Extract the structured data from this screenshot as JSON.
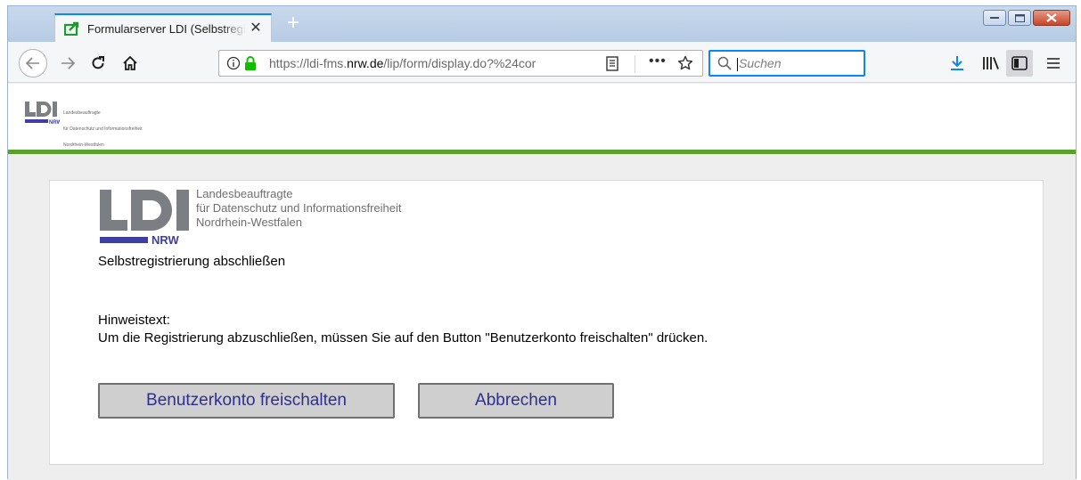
{
  "browser": {
    "tab": {
      "title": "Formularserver LDI (Selbstregistrierung)",
      "close_glyph": "✕"
    },
    "new_tab_glyph": "+",
    "window_controls": [
      "minimize",
      "maximize",
      "close"
    ],
    "url": {
      "prefix": "https://ldi-fms.",
      "domain": "nrw.de",
      "suffix": "/lip/form/display.do?%24cor"
    },
    "url_more_glyph": "•••",
    "search": {
      "placeholder": "Suchen"
    },
    "icons": [
      "back-icon",
      "forward-icon",
      "reload-icon",
      "home-icon",
      "info-icon",
      "lock-icon",
      "reader-view-icon",
      "more-icon",
      "bookmark-star-icon",
      "search-icon",
      "download-icon",
      "library-icon",
      "sidebar-icon",
      "menu-icon"
    ]
  },
  "logo": {
    "letters": "LDI",
    "region": "NRW",
    "lines": [
      "Landesbeauftragte",
      "für Datenschutz und Informationsfreiheit",
      "Nordrhein-Westfalen"
    ]
  },
  "colors": {
    "accent_green": "#5aa02c",
    "logo_gray": "#7b7f83",
    "logo_blue": "#3d3fa3",
    "button_text": "#2f2f8f"
  },
  "form": {
    "title": "Selbstregistrierung abschließen",
    "hint_label": "Hinweistext:",
    "hint_text": "Um die Registrierung abzuschließen, müssen Sie auf den Button \"Benutzerkonto freischalten\" drücken.",
    "buttons": {
      "unlock": "Benutzerkonto freischalten",
      "cancel": "Abbrechen"
    }
  }
}
